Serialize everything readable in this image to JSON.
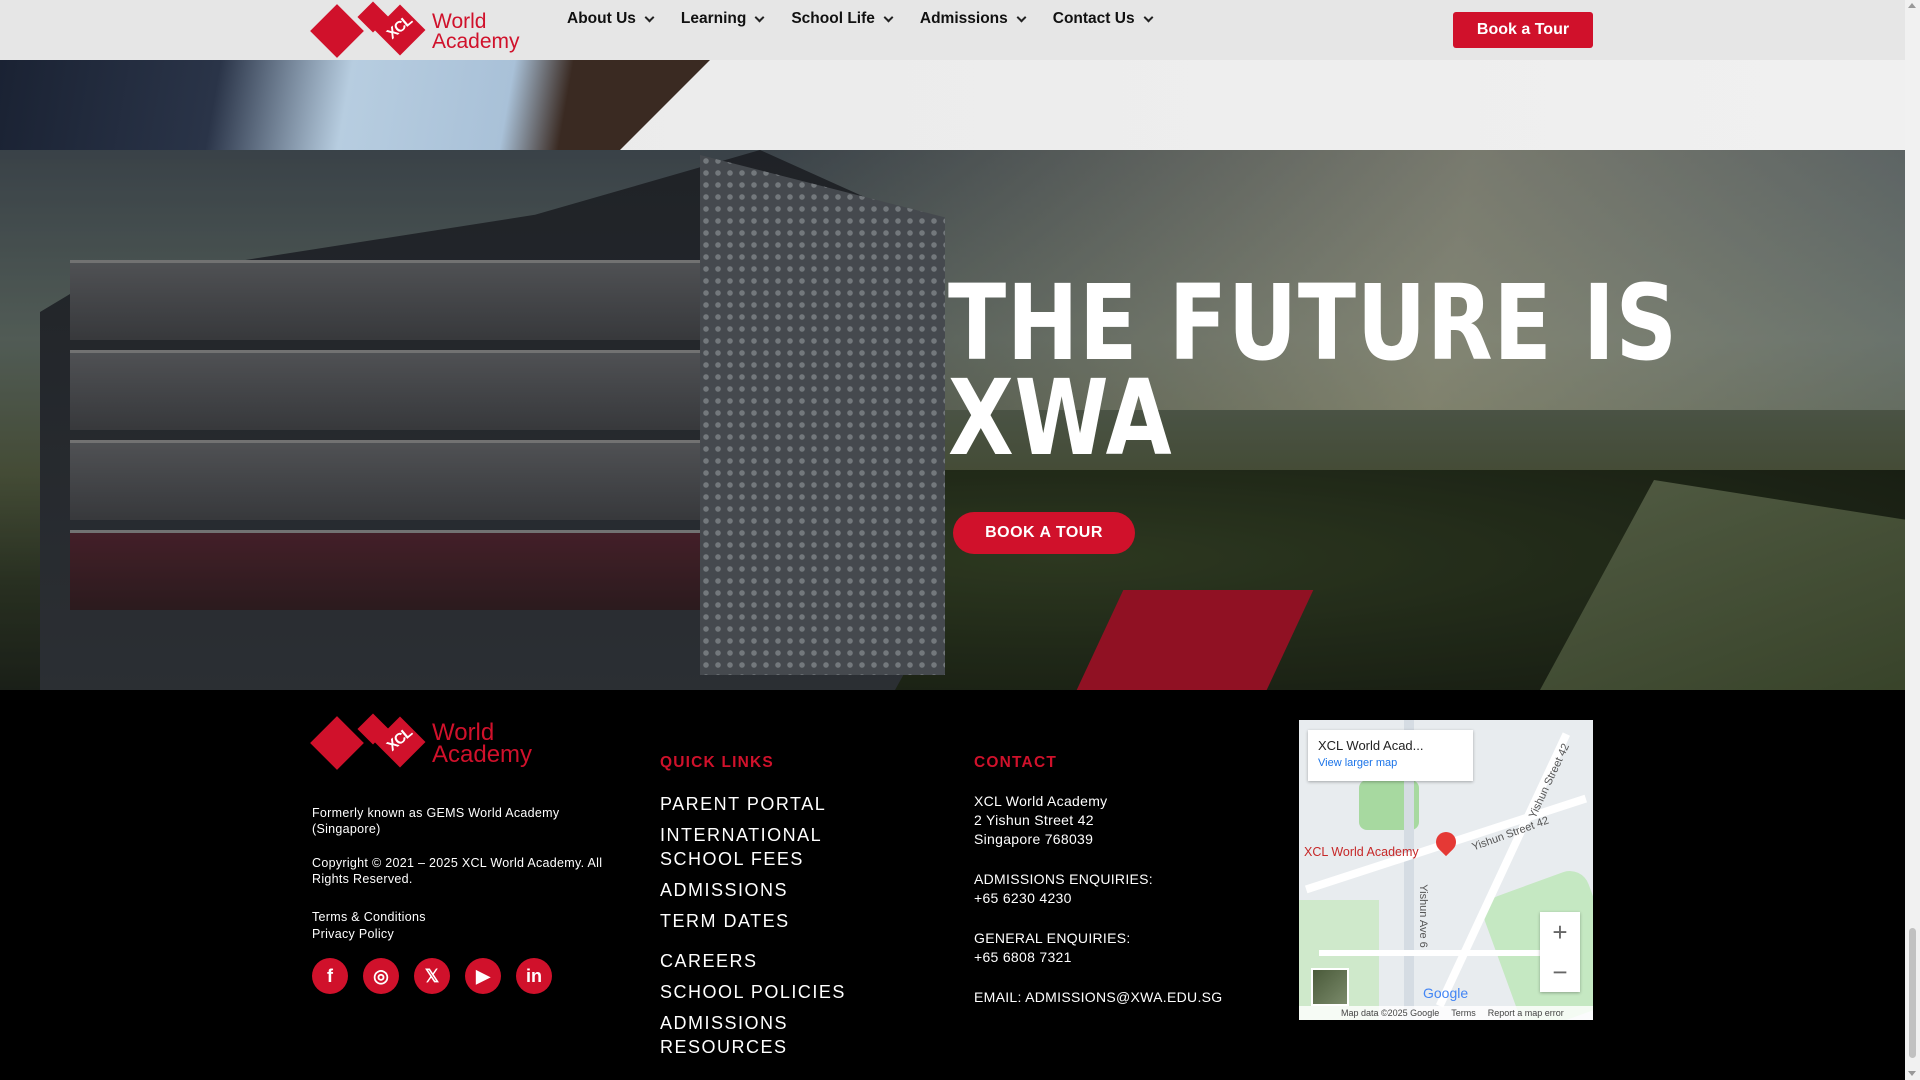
{
  "brand": {
    "name_line1": "World",
    "name_line2": "Academy",
    "mark_text": "XCL",
    "accent_color": "#d0112b"
  },
  "nav": {
    "items": [
      {
        "label": "About Us"
      },
      {
        "label": "Learning"
      },
      {
        "label": "School Life"
      },
      {
        "label": "Admissions"
      },
      {
        "label": "Contact Us"
      }
    ],
    "cta": "Book a Tour"
  },
  "hero": {
    "title_line1": "THE FUTURE IS",
    "title_line2": "XWA",
    "cta": "BOOK A TOUR"
  },
  "footer": {
    "former": "Formerly known as GEMS World Academy (Singapore)",
    "copyright": "Copyright © 2021 – 2025 XCL World Academy. All Rights Reserved.",
    "terms": "Terms & Conditions",
    "privacy": "Privacy Policy",
    "social": [
      {
        "name": "facebook-icon",
        "glyph": "f"
      },
      {
        "name": "instagram-icon",
        "glyph": "◎"
      },
      {
        "name": "x-twitter-icon",
        "glyph": "𝕏"
      },
      {
        "name": "youtube-icon",
        "glyph": "▶"
      },
      {
        "name": "linkedin-icon",
        "glyph": "in"
      }
    ],
    "quick_links_heading": "QUICK LINKS",
    "quick_links": [
      "PARENT PORTAL",
      "INTERNATIONAL SCHOOL FEES",
      "ADMISSIONS",
      "TERM DATES",
      "CAREERS",
      "SCHOOL POLICIES",
      "ADMISSIONS RESOURCES"
    ],
    "contact_heading": "CONTACT",
    "contact": {
      "name": "XCL World Academy",
      "street": "2 Yishun Street 42",
      "city": "Singapore 768039",
      "admissions_label": "ADMISSIONS ENQUIRIES:",
      "admissions_phone": "+65 6230 4230",
      "general_label": "GENERAL ENQUIRIES:",
      "general_phone": "+65 6808 7321",
      "email_line": "EMAIL: ADMISSIONS@XWA.EDU.SG"
    },
    "map": {
      "card_title": "XCL World Acad...",
      "card_link": "View larger map",
      "pin_label": "XCL World Academy",
      "street_a": "Yishun Street 42",
      "street_b": "Yishun Street 42",
      "street_c": "Yishun Ave 6",
      "zoom_in": "+",
      "zoom_out": "−",
      "google": "Google",
      "map_data": "Map data ©2025 Google",
      "terms": "Terms",
      "report": "Report a map error"
    }
  }
}
